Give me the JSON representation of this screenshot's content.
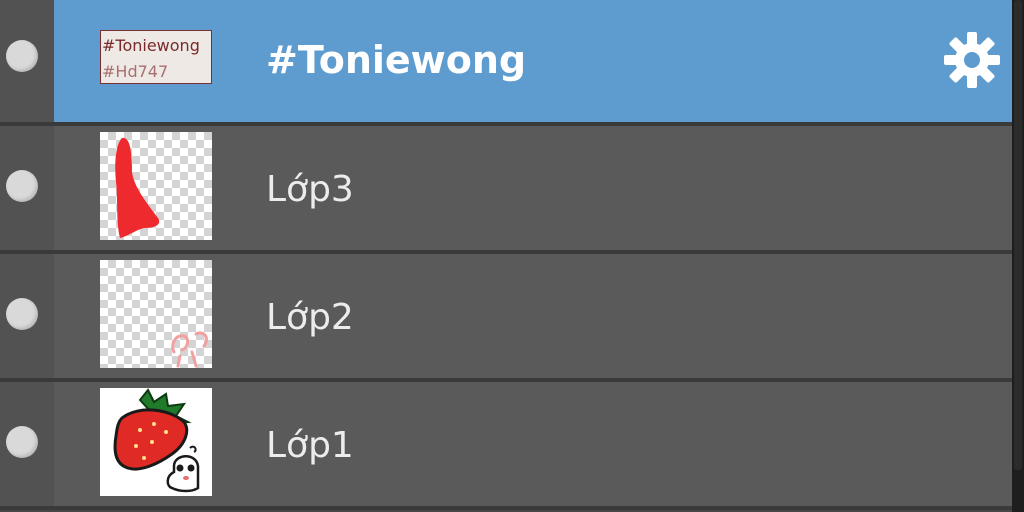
{
  "layers": [
    {
      "name": "#Toniewong",
      "thumb_text": [
        "#Toniewong",
        "#Hd747"
      ],
      "active": true,
      "visible": true
    },
    {
      "name": "Lớp3",
      "active": false,
      "visible": true
    },
    {
      "name": "Lớp2",
      "active": false,
      "visible": true
    },
    {
      "name": "Lớp1",
      "active": false,
      "visible": true
    }
  ],
  "colors": {
    "active_bg": "#5e9ccf",
    "row_bg": "#5a5a5a",
    "accent_red": "#e8272b"
  },
  "icons": {
    "settings": "gear-icon",
    "visibility": "visibility-dot-icon"
  }
}
